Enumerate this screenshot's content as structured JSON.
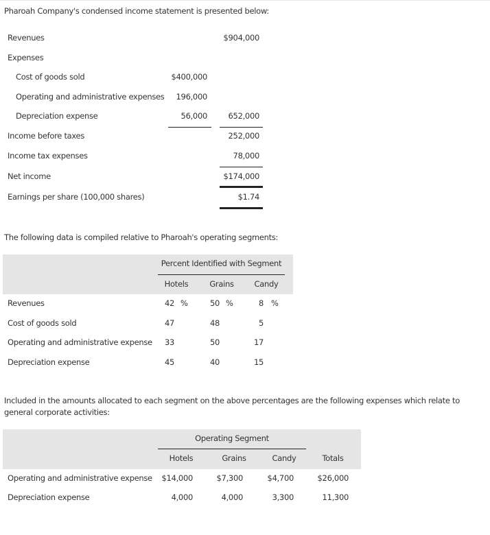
{
  "intro_text": "Pharoah Company's condensed income statement is presented below:",
  "income_statement": {
    "revenues": {
      "label": "Revenues",
      "total": "$904,000"
    },
    "expenses_label": "Expenses",
    "expenses": [
      {
        "label": "Cost of goods sold",
        "amount": "$400,000"
      },
      {
        "label": "Operating and administrative expenses",
        "amount": "196,000"
      },
      {
        "label": "Depreciation expense",
        "amount": "56,000",
        "total": "652,000"
      }
    ],
    "income_before_taxes": {
      "label": "Income before taxes",
      "total": "252,000"
    },
    "income_tax": {
      "label": "Income tax expenses",
      "total": "78,000"
    },
    "net_income": {
      "label": "Net income",
      "total": "$174,000"
    },
    "eps": {
      "label": "Earnings per share (100,000 shares)",
      "total": "$1.74"
    }
  },
  "segment_intro": "The following data is compiled relative to Pharoah's operating segments:",
  "percent_table": {
    "group_header": "Percent Identified with Segment",
    "columns": [
      "Hotels",
      "Grains",
      "Candy"
    ],
    "rows": [
      {
        "label": "Revenues",
        "values": [
          "42",
          "50",
          "8"
        ],
        "unit": "%"
      },
      {
        "label": "Cost of goods sold",
        "values": [
          "47",
          "48",
          "5"
        ]
      },
      {
        "label": "Operating and administrative expense",
        "values": [
          "33",
          "50",
          "17"
        ]
      },
      {
        "label": "Depreciation expense",
        "values": [
          "45",
          "40",
          "15"
        ]
      }
    ]
  },
  "corporate_intro": "Included in the amounts allocated to each segment on the above percentages are the following expenses which relate to general corporate activities:",
  "corporate_table": {
    "group_header": "Operating Segment",
    "columns": [
      "Hotels",
      "Grains",
      "Candy",
      "Totals"
    ],
    "rows": [
      {
        "label": "Operating and administrative expense",
        "values": [
          "$14,000",
          "$7,300",
          "$4,700",
          "$26,000"
        ]
      },
      {
        "label": "Depreciation expense",
        "values": [
          "4,000",
          "4,000",
          "3,300",
          "11,300"
        ]
      }
    ]
  }
}
